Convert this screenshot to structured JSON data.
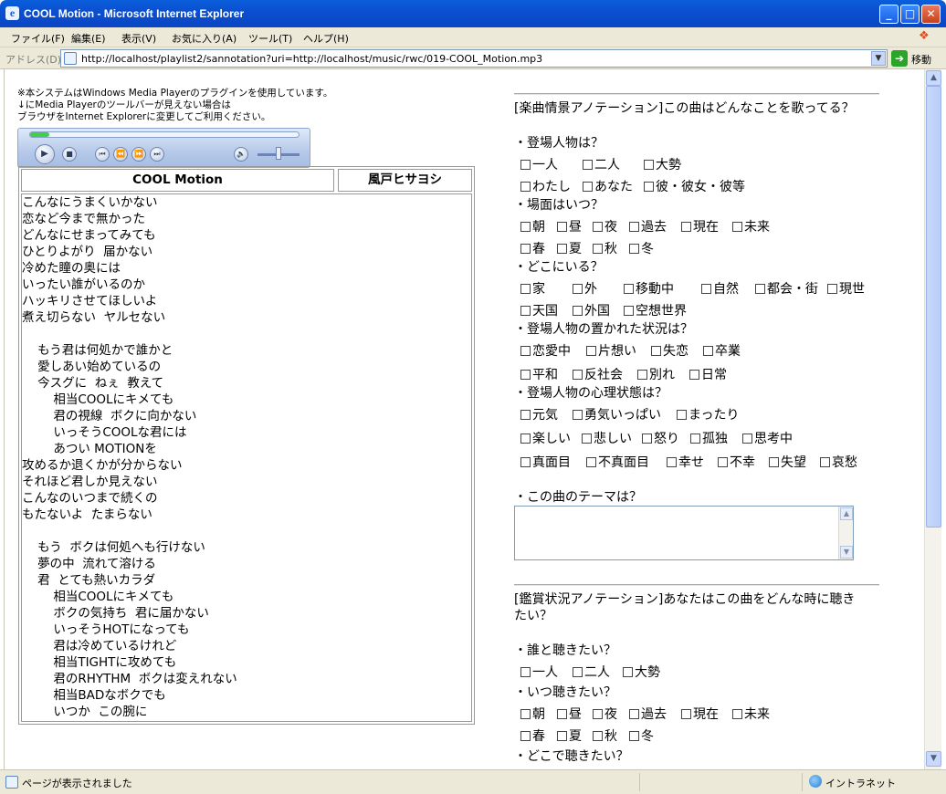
{
  "window": {
    "title": "COOL Motion - Microsoft Internet Explorer"
  },
  "menu": [
    "ファイル(F)",
    "編集(E)",
    "表示(V)",
    "お気に入り(A)",
    "ツール(T)",
    "ヘルプ(H)"
  ],
  "address": {
    "label": "アドレス(D)",
    "url": "http://localhost/playlist2/sannotation?uri=http://localhost/music/rwc/019-COOL_Motion.mp3",
    "go_label": "移動"
  },
  "notice": [
    "※本システムはWindows Media Playerのプラグインを使用しています。",
    "↓にMedia Playerのツールバーが見えない場合は",
    "ブラウザをInternet Explorerに変更してご利用ください。"
  ],
  "player": {
    "progress_fraction": 0.07,
    "volume_fraction": 0.5
  },
  "song": {
    "title": "COOL Motion",
    "artist": "風戸ヒサヨシ"
  },
  "lyrics": [
    "こんなにうまくいかない",
    "恋など今まで無かった",
    "どんなにせまってみても",
    "ひとりよがり  届かない",
    "冷めた瞳の奥には",
    "いったい誰がいるのか",
    "ハッキリさせてほしいよ",
    "煮え切らない  ヤルセない",
    "",
    "    もう君は何処かで誰かと",
    "    愛しあい始めているの",
    "    今スグに  ねぇ  教えて",
    "        相当COOLにキメても",
    "        君の視線  ボクに向かない",
    "        いっそうCOOLな君には",
    "        あつい MOTIONを",
    "攻めるか退くかが分からない",
    "それほど君しか見えない",
    "こんなのいつまで続くの",
    "もたないよ  たまらない",
    "",
    "    もう  ボクは何処へも行けない",
    "    夢の中  流れて溶ける",
    "    君  とても熱いカラダ",
    "        相当COOLにキメても",
    "        ボクの気持ち  君に届かない",
    "        いっそうHOTになっても",
    "        君は冷めているけれど",
    "        相当TIGHTに攻めても",
    "        君のRHYTHM  ボクは変えれない",
    "        相当BADなボクでも",
    "        いつか  この腕に"
  ],
  "annotation1": {
    "header": "[楽曲情景アノテーション]この曲はどんなことを歌ってる？",
    "q_characters": "・登場人物は？",
    "opt_characters": [
      "一人",
      "二人",
      "大勢",
      "わたし",
      "あなた",
      "彼・彼女・彼等"
    ],
    "q_scene": "・場面はいつ？",
    "opt_scene": [
      "朝",
      "昼",
      "夜",
      "過去",
      "現在",
      "未来",
      "春",
      "夏",
      "秋",
      "冬"
    ],
    "q_place": "・どこにいる？",
    "opt_place": [
      "家",
      "外",
      "移動中",
      "自然",
      "都会・街",
      "現世",
      "天国",
      "外国",
      "空想世界"
    ],
    "q_situation": "・登場人物の置かれた状況は？",
    "opt_situation": [
      "恋愛中",
      "片想い",
      "失恋",
      "卒業",
      "平和",
      "反社会",
      "別れ",
      "日常"
    ],
    "q_mood": "・登場人物の心理状態は？",
    "opt_mood": [
      "元気",
      "勇気いっぱい",
      "まったり",
      "楽しい",
      "悲しい",
      "怒り",
      "孤独",
      "思考中",
      "真面目",
      "不真面目",
      "幸せ",
      "不幸",
      "失望",
      "哀愁"
    ],
    "q_theme": "・この曲のテーマは？",
    "theme_value": ""
  },
  "annotation2": {
    "header_line1": "[鑑賞状況アノテーション]あなたはこの曲をどんな時に聴き",
    "header_line2": "たい？",
    "q_who": "・誰と聴きたい？",
    "opt_who": [
      "一人",
      "二人",
      "大勢"
    ],
    "q_when": "・いつ聴きたい？",
    "opt_when": [
      "朝",
      "昼",
      "夜",
      "過去",
      "現在",
      "未来",
      "春",
      "夏",
      "秋",
      "冬"
    ],
    "q_where": "・どこで聴きたい？"
  },
  "status": {
    "message": "ページが表示されました",
    "zone": "イントラネット"
  }
}
